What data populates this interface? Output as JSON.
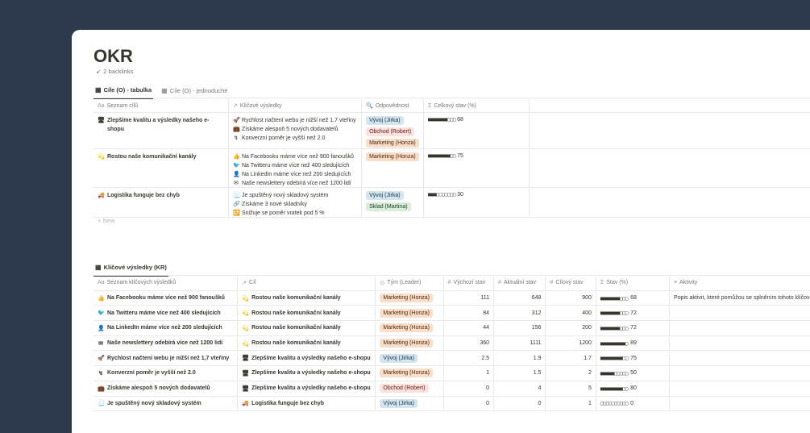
{
  "page": {
    "title": "OKR",
    "backlinks": "2 backlinks"
  },
  "tabs1": [
    {
      "label": "Cíle (O) - tabulka",
      "icon": "table-icon"
    },
    {
      "label": "Cíle (O) - jednoduché",
      "icon": "board-icon"
    }
  ],
  "table1": {
    "headers": [
      "Seznam cílů",
      "Klíčové výsledky",
      "Odpovědnost",
      "Celkový stav (%)"
    ],
    "header_icons": [
      "Aa",
      "↗",
      "🔍",
      "Σ"
    ],
    "rows": [
      {
        "goal": "Zlepšíme kvalitu a výsledky našeho e-shopu",
        "goal_emoji": "🖥",
        "krs": [
          {
            "emoji": "🚀",
            "text": "Rychlost načtení webu je nižší než 1,7 vteřiny"
          },
          {
            "emoji": "💼",
            "text": "Získáme alespoň 5 nových dodavatelů"
          },
          {
            "emoji": "↯",
            "text": "Konverzní poměr je vyšší než 2.0"
          }
        ],
        "owners": [
          {
            "text": "Vývoj (Jirka)",
            "color": "blue"
          },
          {
            "text": "Obchod (Robert)",
            "color": "red"
          },
          {
            "text": "Marketing (Honza)",
            "color": "orange"
          }
        ],
        "progress_bar": "■■■■■■■▢▢▢",
        "progress": "68"
      },
      {
        "goal": "Rostou naše komunikační kanály",
        "goal_emoji": "💫",
        "krs": [
          {
            "emoji": "👍",
            "text": "Na Facebooku máme více než 900 fanoušků"
          },
          {
            "emoji": "🐦",
            "text": "Na Twitteru máme více než 400 sledujících"
          },
          {
            "emoji": "👤",
            "text": "Na LinkedIn máme více než 200 sledujících"
          },
          {
            "emoji": "✉",
            "text": "Naše newslettery odebírá více než 1200 lidí"
          }
        ],
        "owners": [
          {
            "text": "Marketing (Honza)",
            "color": "orange"
          }
        ],
        "progress_bar": "■■■■■■■■▢▢",
        "progress": "75"
      },
      {
        "goal": "Logistika funguje bez chyb",
        "goal_emoji": "🚚",
        "krs": [
          {
            "emoji": "📃",
            "text": "Je spuštěný nový skladový systém"
          },
          {
            "emoji": "🔗",
            "text": "Získáme 3 nové skladníky"
          },
          {
            "emoji": "🔁",
            "text": "Snižuje se poměr vratek pod 5 %"
          }
        ],
        "owners": [
          {
            "text": "Vývoj (Jirka)",
            "color": "blue"
          },
          {
            "text": "Sklad (Martina)",
            "color": "green"
          }
        ],
        "progress_bar": "■■■▢▢▢▢▢▢▢",
        "progress": "30"
      }
    ],
    "new_label": "New"
  },
  "tabs2": [
    {
      "label": "Klíčové výsledky (KR)",
      "icon": "table-icon"
    }
  ],
  "table2": {
    "headers": [
      "Seznam klíčových výsledků",
      "Cíl",
      "Tým (Leader)",
      "Výchozí stav",
      "Aktuální stav",
      "Cílový stav",
      "Stav (%)",
      "Aktivity"
    ],
    "header_icons": [
      "Aa",
      "↗",
      "⊙",
      "#",
      "#",
      "#",
      "Σ",
      "≡"
    ],
    "rows": [
      {
        "emoji": "👍",
        "kr": "Na Facebooku máme více než 900 fanoušků",
        "goal_emoji": "💫",
        "goal": "Rostou naše komunikační kanály",
        "team": "Marketing (Honza)",
        "team_color": "orange",
        "start": "111",
        "current": "648",
        "target": "900",
        "bar": "■■■■■■■▢▢▢",
        "pct": "68",
        "activity": "Popis aktivit, které pomůžou se splněním tohoto klíčového"
      },
      {
        "emoji": "🐦",
        "kr": "Na Twitteru máme více než 400 sledujících",
        "goal_emoji": "💫",
        "goal": "Rostou naše komunikační kanály",
        "team": "Marketing (Honza)",
        "team_color": "orange",
        "start": "84",
        "current": "312",
        "target": "400",
        "bar": "■■■■■■■▢▢▢",
        "pct": "72",
        "activity": ""
      },
      {
        "emoji": "👤",
        "kr": "Na LinkedIn máme více než 200 sledujících",
        "goal_emoji": "💫",
        "goal": "Rostou naše komunikační kanály",
        "team": "Marketing (Honza)",
        "team_color": "orange",
        "start": "44",
        "current": "156",
        "target": "200",
        "bar": "■■■■■■■▢▢▢",
        "pct": "72",
        "activity": ""
      },
      {
        "emoji": "✉",
        "kr": "Naše newslettery odebírá více než 1200 lidí",
        "goal_emoji": "💫",
        "goal": "Rostou naše komunikační kanály",
        "team": "Marketing (Honza)",
        "team_color": "orange",
        "start": "360",
        "current": "1111",
        "target": "1200",
        "bar": "■■■■■■■■■▢",
        "pct": "89",
        "activity": ""
      },
      {
        "emoji": "🚀",
        "kr": "Rychlost načtení webu je nižší než 1,7 vteřiny",
        "goal_emoji": "🖥",
        "goal": "Zlepšíme kvalitu a výsledky našeho e-shopu",
        "team": "Vývoj (Jirka)",
        "team_color": "blue",
        "start": "2.5",
        "current": "1.9",
        "target": "1.7",
        "bar": "■■■■■■■■▢▢",
        "pct": "75",
        "activity": ""
      },
      {
        "emoji": "↯",
        "kr": "Konverzní poměr je vyšší než 2.0",
        "goal_emoji": "🖥",
        "goal": "Zlepšíme kvalitu a výsledky našeho e-shopu",
        "team": "Marketing (Honza)",
        "team_color": "orange",
        "start": "1",
        "current": "1.5",
        "target": "2",
        "bar": "■■■■■▢▢▢▢▢",
        "pct": "50",
        "activity": ""
      },
      {
        "emoji": "💼",
        "kr": "Získáme alespoň 5 nových dodavatelů",
        "goal_emoji": "🖥",
        "goal": "Zlepšíme kvalitu a výsledky našeho e-shopu",
        "team": "Obchod (Robert)",
        "team_color": "red",
        "start": "0",
        "current": "4",
        "target": "5",
        "bar": "■■■■■■■■▢▢",
        "pct": "80",
        "activity": ""
      },
      {
        "emoji": "📃",
        "kr": "Je spuštěný nový skladový systém",
        "goal_emoji": "🚚",
        "goal": "Logistika funguje bez chyb",
        "team": "Vývoj (Jirka)",
        "team_color": "blue",
        "start": "0",
        "current": "0",
        "target": "1",
        "bar": "▢▢▢▢▢▢▢▢▢▢",
        "pct": "0",
        "activity": ""
      }
    ]
  },
  "colors": {
    "background": "#2d3a4d",
    "tag_blue": "#d3e5ef",
    "tag_red": "#ffe2dd",
    "tag_orange": "#fadec9",
    "tag_green": "#dbeddb"
  }
}
